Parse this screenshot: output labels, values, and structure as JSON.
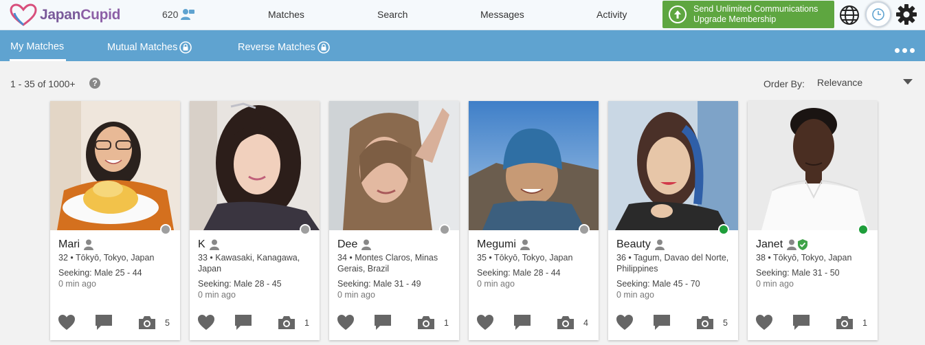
{
  "header": {
    "logo_text_1": "Japan",
    "logo_text_2": "Cupid",
    "online_count": "620",
    "nav": [
      "Matches",
      "Search",
      "Messages",
      "Activity"
    ],
    "upgrade_line1": "Send Unlimited Communications",
    "upgrade_line2": "Upgrade Membership"
  },
  "subnav": {
    "tabs": [
      "My Matches",
      "Mutual Matches",
      "Reverse Matches"
    ],
    "active": "My Matches"
  },
  "results": {
    "count": "1 - 35 of 1000+",
    "help": "?",
    "order_label": "Order By:",
    "order_value": "Relevance"
  },
  "colors": {
    "online": "#1e9e3a",
    "offline": "#9e9e9e",
    "accent": "#5fa3d0",
    "upgrade": "#5ea640"
  },
  "profiles": [
    {
      "name": "Mari",
      "details": "32 • Tōkyō, Tokyo, Japan",
      "seeking": "Seeking: Male 25 - 44",
      "ago": "0 min ago",
      "photos": "5"
    },
    {
      "name": "K",
      "details": "33 • Kawasaki, Kanagawa, Japan",
      "seeking": "Seeking: Male 28 - 45",
      "ago": "0 min ago",
      "photos": "1"
    },
    {
      "name": "Dee",
      "details": "34 • Montes Claros, Minas Gerais, Brazil",
      "seeking": "Seeking: Male 31 - 49",
      "ago": "0 min ago",
      "photos": "1"
    },
    {
      "name": "Megumi",
      "details": "35 • Tōkyō, Tokyo, Japan",
      "seeking": "Seeking: Male 28 - 44",
      "ago": "0 min ago",
      "photos": "4"
    },
    {
      "name": "Beauty",
      "details": "36 • Tagum, Davao del Norte, Philippines",
      "seeking": "Seeking: Male 45 - 70",
      "ago": "0 min ago",
      "photos": "5"
    },
    {
      "name": "Janet",
      "details": "38 • Tōkyō, Tokyo, Japan",
      "seeking": "Seeking: Male 31 - 50",
      "ago": "0 min ago",
      "photos": "1"
    }
  ]
}
